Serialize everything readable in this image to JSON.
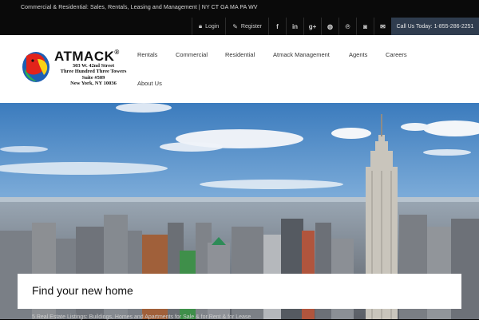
{
  "topbar": {
    "tagline": "Commercial & Residential: Sales, Rentals, Leasing and Management | NY CT GA MA PA WV",
    "login_label": "Login",
    "register_label": "Register",
    "social": [
      {
        "name": "facebook-icon",
        "glyph": "f"
      },
      {
        "name": "linkedin-icon",
        "glyph": "in"
      },
      {
        "name": "google-plus-icon",
        "glyph": "g+"
      },
      {
        "name": "dribbble-icon",
        "glyph": "◍"
      },
      {
        "name": "pinterest-icon",
        "glyph": "℗"
      },
      {
        "name": "instagram-icon",
        "glyph": "◙"
      },
      {
        "name": "email-icon",
        "glyph": "✉"
      }
    ],
    "call_label": "Call Us Today: 1-855-286-2251"
  },
  "logo": {
    "name": "ATMACK",
    "reg": "®",
    "address_lines": [
      "303 W. 42nd Street",
      "Three Hundred Three Towers",
      "Suite #509",
      "New York, NY 10036"
    ]
  },
  "nav": {
    "items": [
      "Rentals",
      "Commercial",
      "Residential",
      "Atmack Management",
      "Agents",
      "Careers",
      "About Us"
    ]
  },
  "hero": {
    "search_title": "Find your new home",
    "subline": "5 Real Estate Listings: Buildings, Homes and Apartments for Sale & for Rent & for Lease"
  },
  "colors": {
    "call_button": "#2f3c4e",
    "sky_top": "#3b7bbd",
    "logo_red": "#e2231a",
    "logo_yellow": "#f7d117",
    "logo_blue": "#1d5fb4"
  }
}
